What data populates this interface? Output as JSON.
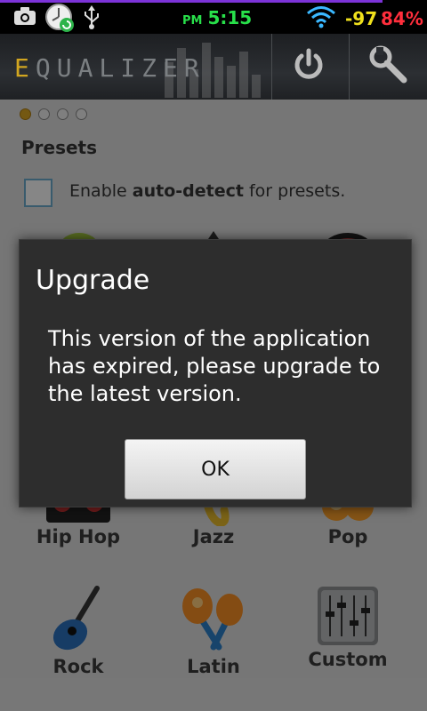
{
  "status_bar": {
    "ampm": "PM",
    "time": "5:15",
    "signal": "-97",
    "battery": "84%",
    "icons": [
      "camera-icon",
      "clock-sync-icon",
      "usb-icon",
      "wifi-icon"
    ]
  },
  "app": {
    "title_first": "E",
    "title_rest": "QUALIZER",
    "icons": [
      "power-icon",
      "settings-wrench-icon"
    ]
  },
  "content": {
    "page_dots": 4,
    "active_dot": 0,
    "presets_label": "Presets",
    "autodetect_pre": "Enable ",
    "autodetect_bold": "auto-detect",
    "autodetect_post": " for presets.",
    "presets": [
      {
        "label": "Hip Hop",
        "icon": "turntable-icon"
      },
      {
        "label": "Jazz",
        "icon": "saxophone-icon"
      },
      {
        "label": "Pop",
        "icon": "pop-icon"
      },
      {
        "label": "Rock",
        "icon": "guitar-icon"
      },
      {
        "label": "Latin",
        "icon": "maracas-icon"
      },
      {
        "label": "Custom",
        "icon": "mixer-sliders-icon"
      }
    ]
  },
  "dialog": {
    "title": "Upgrade",
    "message": "This version of the application has expired, please upgrade to the latest version.",
    "ok_label": "OK"
  },
  "colors": {
    "accent": "#d2a620",
    "time": "#28e04a",
    "signal": "#f0e11c",
    "battery": "#ff2e3c"
  }
}
